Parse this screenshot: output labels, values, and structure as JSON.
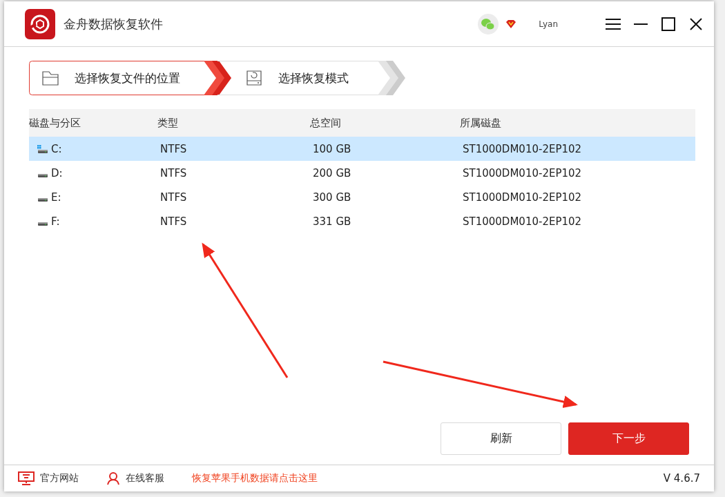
{
  "window": {
    "title": "金舟数据恢复软件",
    "user": "Lyan"
  },
  "steps": [
    {
      "label": "选择恢复文件的位置",
      "kind": "location",
      "selected": true
    },
    {
      "label": "选择恢复模式",
      "kind": "mode",
      "selected": false
    }
  ],
  "table": {
    "columns": [
      "磁盘与分区",
      "类型",
      "总空间",
      "所属磁盘"
    ],
    "rows": [
      {
        "kind": "system",
        "selected": true,
        "cells": [
          "C:",
          "NTFS",
          "100 GB",
          "ST1000DM010-2EP102"
        ]
      },
      {
        "kind": "drive",
        "selected": false,
        "cells": [
          "D:",
          "NTFS",
          "200 GB",
          "ST1000DM010-2EP102"
        ]
      },
      {
        "kind": "drive",
        "selected": false,
        "cells": [
          "E:",
          "NTFS",
          "300 GB",
          "ST1000DM010-2EP102"
        ]
      },
      {
        "kind": "drive",
        "selected": false,
        "cells": [
          "F:",
          "NTFS",
          "331 GB",
          "ST1000DM010-2EP102"
        ]
      }
    ]
  },
  "buttons": [
    {
      "label": "刷新",
      "kind": "secondary"
    },
    {
      "label": "下一步",
      "kind": "primary"
    }
  ],
  "footer": {
    "links": [
      {
        "label": "官方网站",
        "kind": "website"
      },
      {
        "label": "在线客服",
        "kind": "support"
      }
    ],
    "promo": "恢复苹果手机数据请点击这里",
    "version": "V 4.6.7"
  }
}
